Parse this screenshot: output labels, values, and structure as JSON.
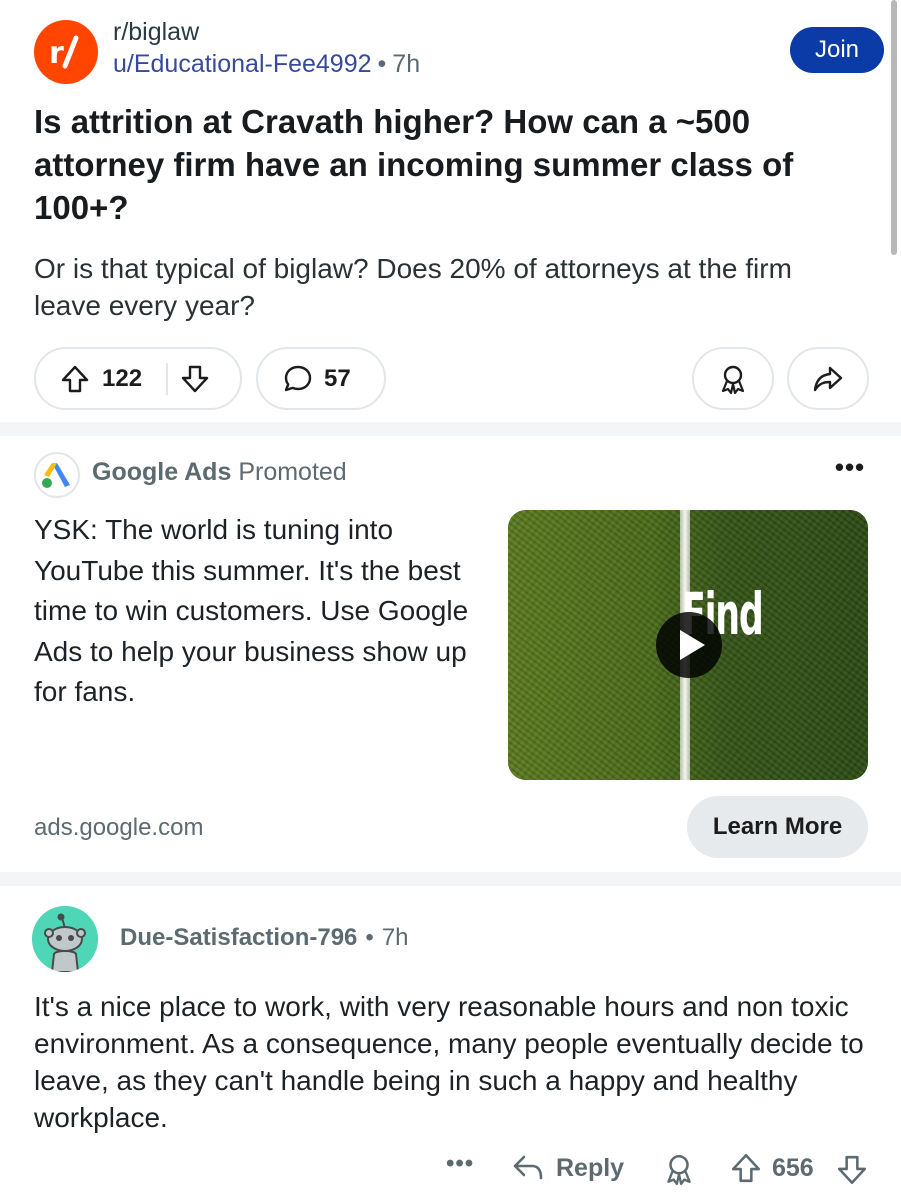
{
  "post": {
    "subreddit": "r/biglaw",
    "author": "u/Educational-Fee4992",
    "separator": "•",
    "age": "7h",
    "join_label": "Join",
    "title": "Is attrition at Cravath higher? How can a ~500 attorney firm have an incoming summer class of 100+?",
    "body": "Or is that typical of biglaw? Does 20% of attorneys at the firm leave every year?",
    "score": "122",
    "comment_count": "57"
  },
  "ad": {
    "advertiser": "Google Ads",
    "promoted_label": "Promoted",
    "more_label": "•••",
    "text": "YSK: The world is tuning into YouTube this summer. It's the best time to win customers. Use Google Ads to help your business show up for fans.",
    "media_overlay_text": "Find",
    "domain": "ads.google.com",
    "cta_label": "Learn More"
  },
  "comment": {
    "username": "Due-Satisfaction-796",
    "separator": "•",
    "age": "7h",
    "body": "It's a nice place to work, with very reasonable hours and non toxic environment. As a consequence, many people eventually decide to leave, as they can't handle being in such a happy and healthy workplace.",
    "more_label": "•••",
    "reply_label": "Reply",
    "score": "656"
  },
  "colors": {
    "subreddit_avatar": "#ff4500",
    "join_button": "#0a3ba6",
    "author_link": "#37499b",
    "comment_avatar": "#4fd6b6",
    "cta_button": "#e6eaec"
  },
  "icons": {
    "post_upvote": "arrow-up-icon",
    "post_downvote": "arrow-down-icon",
    "comments": "speech-bubble-icon",
    "award": "award-ribbon-icon",
    "share": "share-arrow-icon",
    "play": "play-icon",
    "reply": "reply-arrow-icon"
  }
}
